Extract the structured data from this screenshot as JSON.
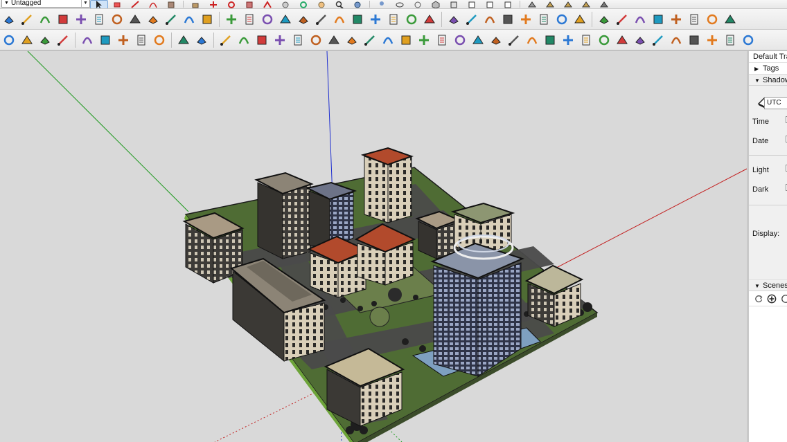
{
  "toolbar_top": {
    "tag_select_value": "Untagged"
  },
  "tray": {
    "title": "Default Tray",
    "tags_label": "Tags",
    "shadows_label": "Shadows",
    "timezone_value": "UTC",
    "time_label": "Time",
    "date_label": "Date",
    "light_label": "Light",
    "dark_label": "Dark",
    "display_label": "Display:",
    "scenes_label": "Scenes"
  },
  "colors": {
    "accent_select": "#3b7fd4",
    "axis_red": "#c21f1f",
    "axis_green": "#1f9a1f",
    "axis_blue": "#1f2fd0",
    "ground": "#5e7a3c",
    "road": "#4a4a4a"
  },
  "icons": [
    "layer-icon",
    "blue-box-icon",
    "paint-icon",
    "eraser-icon",
    "select-arrow-icon",
    "rect-icon",
    "line-icon",
    "arc-icon",
    "push-pull-icon",
    "move-icon",
    "rotate-icon",
    "scale-icon",
    "offset-icon",
    "tape-icon",
    "dimension-icon",
    "protractor-icon",
    "text-icon",
    "axes-icon",
    "3d-text-icon",
    "orbit-icon",
    "pan-icon",
    "zoom-icon",
    "zoom-extents-icon",
    "iso-view-icon",
    "top-view-icon",
    "front-view-icon",
    "right-view-icon",
    "back-view-icon",
    "left-view-icon",
    "xray-icon",
    "wireframe-icon",
    "hidden-line-icon",
    "shaded-icon",
    "textured-icon",
    "monochrome-icon",
    "section-plane-icon",
    "sandbox-icon",
    "warehouse-icon",
    "extension-icon",
    "settings-icon",
    "mail-icon",
    "info-icon",
    "add-location-icon"
  ]
}
